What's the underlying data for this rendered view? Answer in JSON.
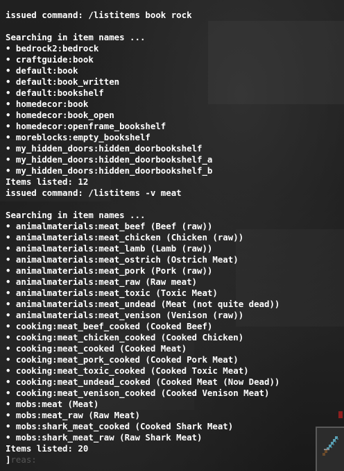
{
  "chat": {
    "lines": [
      "issued command: /listitems book rock",
      "",
      "Searching in item names ...",
      "• bedrock2:bedrock",
      "• craftguide:book",
      "• default:book",
      "• default:book_written",
      "• default:bookshelf",
      "• homedecor:book",
      "• homedecor:book_open",
      "• homedecor:openframe_bookshelf",
      "• moreblocks:empty_bookshelf",
      "• my_hidden_doors:hidden_doorbookshelf",
      "• my_hidden_doors:hidden_doorbookshelf_a",
      "• my_hidden_doors:hidden_doorbookshelf_b",
      "Items listed: 12",
      "issued command: /listitems -v meat",
      "",
      "Searching in item names ...",
      "• animalmaterials:meat_beef (Beef (raw))",
      "• animalmaterials:meat_chicken (Chicken (raw))",
      "• animalmaterials:meat_lamb (Lamb (raw))",
      "• animalmaterials:meat_ostrich (Ostrich Meat)",
      "• animalmaterials:meat_pork (Pork (raw))",
      "• animalmaterials:meat_raw (Raw meat)",
      "• animalmaterials:meat_toxic (Toxic Meat)",
      "• animalmaterials:meat_undead (Meat (not quite dead))",
      "• animalmaterials:meat_venison (Venison (raw))",
      "• cooking:meat_beef_cooked (Cooked Beef)",
      "• cooking:meat_chicken_cooked (Cooked Chicken)",
      "• cooking:meat_cooked (Cooked Meat)",
      "• cooking:meat_pork_cooked (Cooked Pork Meat)",
      "• cooking:meat_toxic_cooked (Cooked Toxic Meat)",
      "• cooking:meat_undead_cooked (Cooked Meat (Now Dead))",
      "• cooking:meat_venison_cooked (Cooked Venison Meat)",
      "• mobs:meat (Meat)",
      "• mobs:meat_raw (Raw Meat)",
      "• mobs:shark_meat_cooked (Cooked Shark Meat)",
      "• mobs:shark_meat_raw (Raw Shark Meat)",
      "Items listed: 20"
    ],
    "input": {
      "cursor": "]",
      "hint": "reas:"
    }
  },
  "hotbar": {
    "item_icon": "sword-icon"
  },
  "colors": {
    "text": "#ffffff",
    "hint": "#555555",
    "background": "#1b1b1b",
    "slot_border": "#5a5a5a",
    "sword_blade": "#5aa0b4"
  }
}
